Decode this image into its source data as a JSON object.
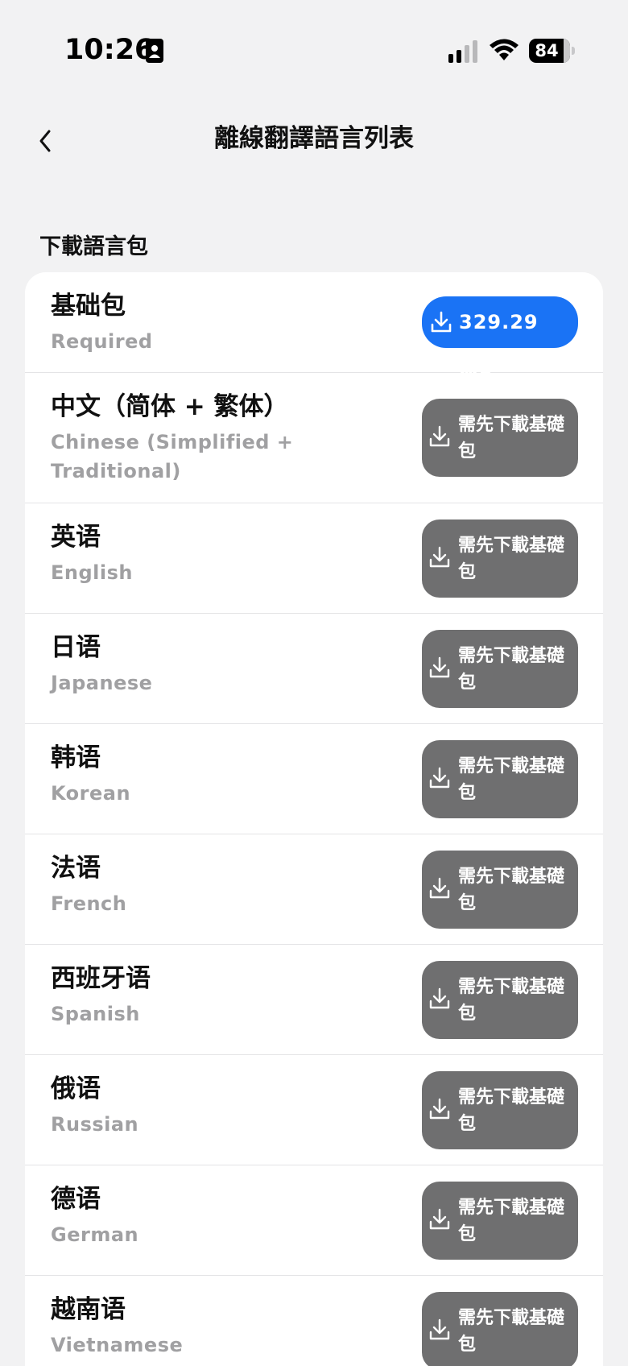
{
  "status_bar": {
    "time": "10:26",
    "battery": "84"
  },
  "nav": {
    "title": "離線翻譯語言列表"
  },
  "section": {
    "header": "下載語言包"
  },
  "base_pack": {
    "name": "基础包",
    "subtitle": "Required",
    "button_label": "329.29 MB"
  },
  "languages": [
    {
      "name": "中文（简体 + 繁体）",
      "subtitle": "Chinese (Simplified + Traditional)",
      "button_label": "需先下載基礎包"
    },
    {
      "name": "英语",
      "subtitle": "English",
      "button_label": "需先下載基礎包"
    },
    {
      "name": "日语",
      "subtitle": "Japanese",
      "button_label": "需先下載基礎包"
    },
    {
      "name": "韩语",
      "subtitle": "Korean",
      "button_label": "需先下載基礎包"
    },
    {
      "name": "法语",
      "subtitle": "French",
      "button_label": "需先下載基礎包"
    },
    {
      "name": "西班牙语",
      "subtitle": "Spanish",
      "button_label": "需先下載基礎包"
    },
    {
      "name": "俄语",
      "subtitle": "Russian",
      "button_label": "需先下載基礎包"
    },
    {
      "name": "德语",
      "subtitle": "German",
      "button_label": "需先下載基礎包"
    },
    {
      "name": "越南语",
      "subtitle": "Vietnamese",
      "button_label": "需先下載基礎包"
    }
  ],
  "colors": {
    "primary": "#1a73f5",
    "disabled_button": "#6f6f70",
    "subtitle": "#a0a0a2",
    "background": "#f2f2f3"
  },
  "icons": {
    "back": "chevron-left-icon",
    "download": "download-icon",
    "signal": "cellular-signal-icon",
    "wifi": "wifi-icon",
    "battery": "battery-icon",
    "contact": "contact-card-icon"
  }
}
